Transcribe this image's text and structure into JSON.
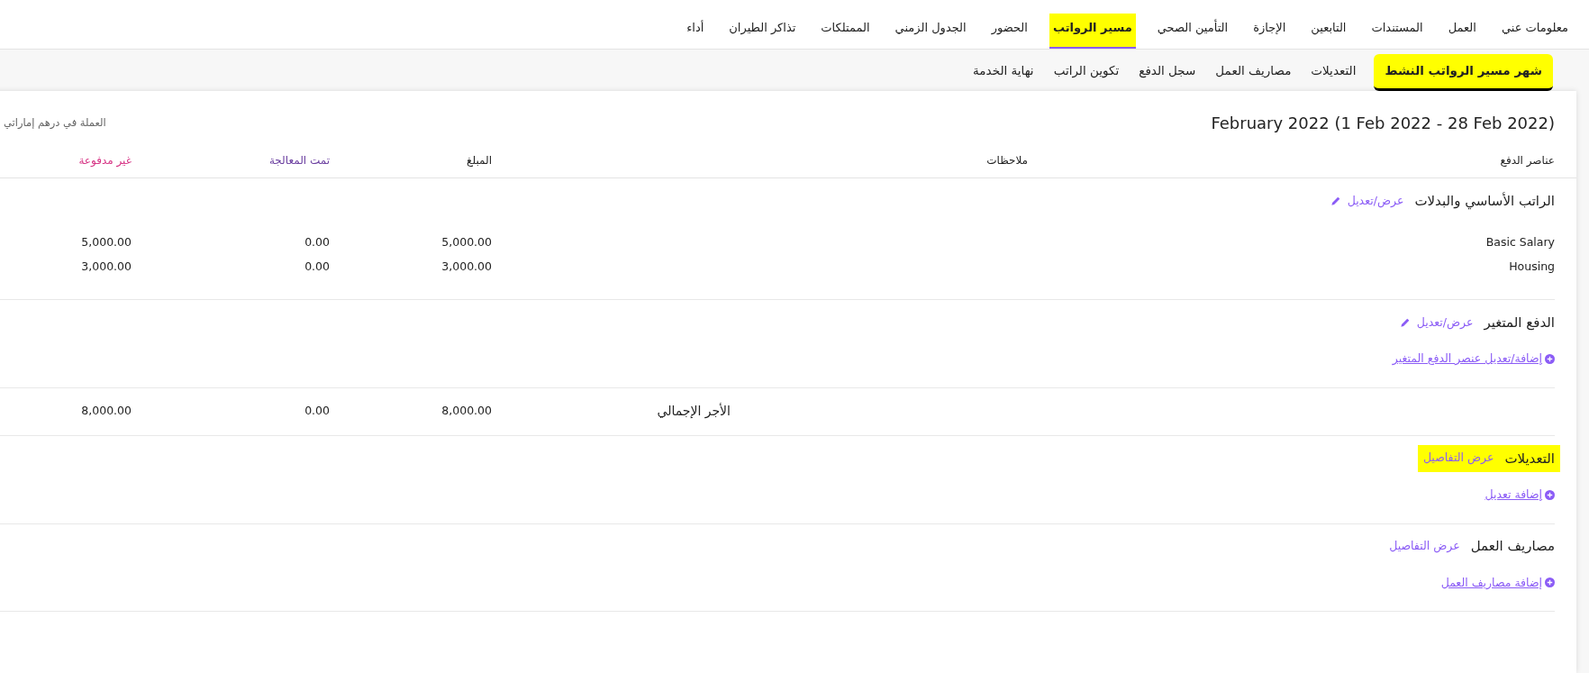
{
  "top_nav": [
    {
      "label": "معلومات عني",
      "selected": false,
      "highlighted": false
    },
    {
      "label": "العمل",
      "selected": false,
      "highlighted": false
    },
    {
      "label": "المستندات",
      "selected": false,
      "highlighted": false
    },
    {
      "label": "التابعين",
      "selected": false,
      "highlighted": false
    },
    {
      "label": "الإجازة",
      "selected": false,
      "highlighted": false
    },
    {
      "label": "التأمين الصحي",
      "selected": false,
      "highlighted": false
    },
    {
      "label": "مسير الرواتب",
      "selected": true,
      "highlighted": true
    },
    {
      "label": "الحضور",
      "selected": false,
      "highlighted": false
    },
    {
      "label": "الجدول الزمني",
      "selected": false,
      "highlighted": false
    },
    {
      "label": "الممتلكات",
      "selected": false,
      "highlighted": false
    },
    {
      "label": "تذاكر الطيران",
      "selected": false,
      "highlighted": false
    },
    {
      "label": "أداء",
      "selected": false,
      "highlighted": false
    }
  ],
  "sub_tabs": [
    {
      "label": "شهر مسير الرواتب النشط",
      "selected": true,
      "highlighted": true
    },
    {
      "label": "التعديلات",
      "selected": false,
      "highlighted": false
    },
    {
      "label": "مصاريف العمل",
      "selected": false,
      "highlighted": false
    },
    {
      "label": "سجل الدفع",
      "selected": false,
      "highlighted": false
    },
    {
      "label": "تكوين الراتب",
      "selected": false,
      "highlighted": false
    },
    {
      "label": "نهاية الخدمة",
      "selected": false,
      "highlighted": false
    }
  ],
  "period_title": "February 2022 (1 Feb 2022 - 28 Feb 2022)",
  "currency_note": "العملة في درهم إماراتي",
  "columns": [
    {
      "label": "عناصر الدفع",
      "color": "#222222"
    },
    {
      "label": "ملاحظات",
      "color": "#222222"
    },
    {
      "label": "المبلغ",
      "color": "#222222"
    },
    {
      "label": "تمت المعالجة",
      "color": "#6b3fa0"
    },
    {
      "label": "غير مدفوعة",
      "color": "#d63384"
    }
  ],
  "sections": [
    {
      "kind": "editable",
      "title": "الراتب الأساسي والبدلات",
      "action": "عرض/تعديل",
      "highlighted": false,
      "rows": [
        {
          "item": "Basic Salary",
          "amount": "5,000.00",
          "processed": "0.00",
          "unpaid": "5,000.00"
        },
        {
          "item": "Housing",
          "amount": "3,000.00",
          "processed": "0.00",
          "unpaid": "3,000.00"
        }
      ]
    },
    {
      "kind": "editable",
      "title": "الدفع المتغير",
      "action": "عرض/تعديل",
      "highlighted": false,
      "add_link": "إضافة/تعديل عنصر الدفع المتغير"
    },
    {
      "kind": "total",
      "label": "الأجر الإجمالي",
      "amount": "8,000.00",
      "processed": "0.00",
      "unpaid": "8,000.00"
    },
    {
      "kind": "details",
      "title": "التعديلات",
      "action": "عرض التفاصيل",
      "highlighted": true,
      "add_link": "إضافة تعديل"
    },
    {
      "kind": "details",
      "title": "مصاريف العمل",
      "action": "عرض التفاصيل",
      "highlighted": false,
      "add_link": "إضافة مصاريف العمل"
    }
  ]
}
